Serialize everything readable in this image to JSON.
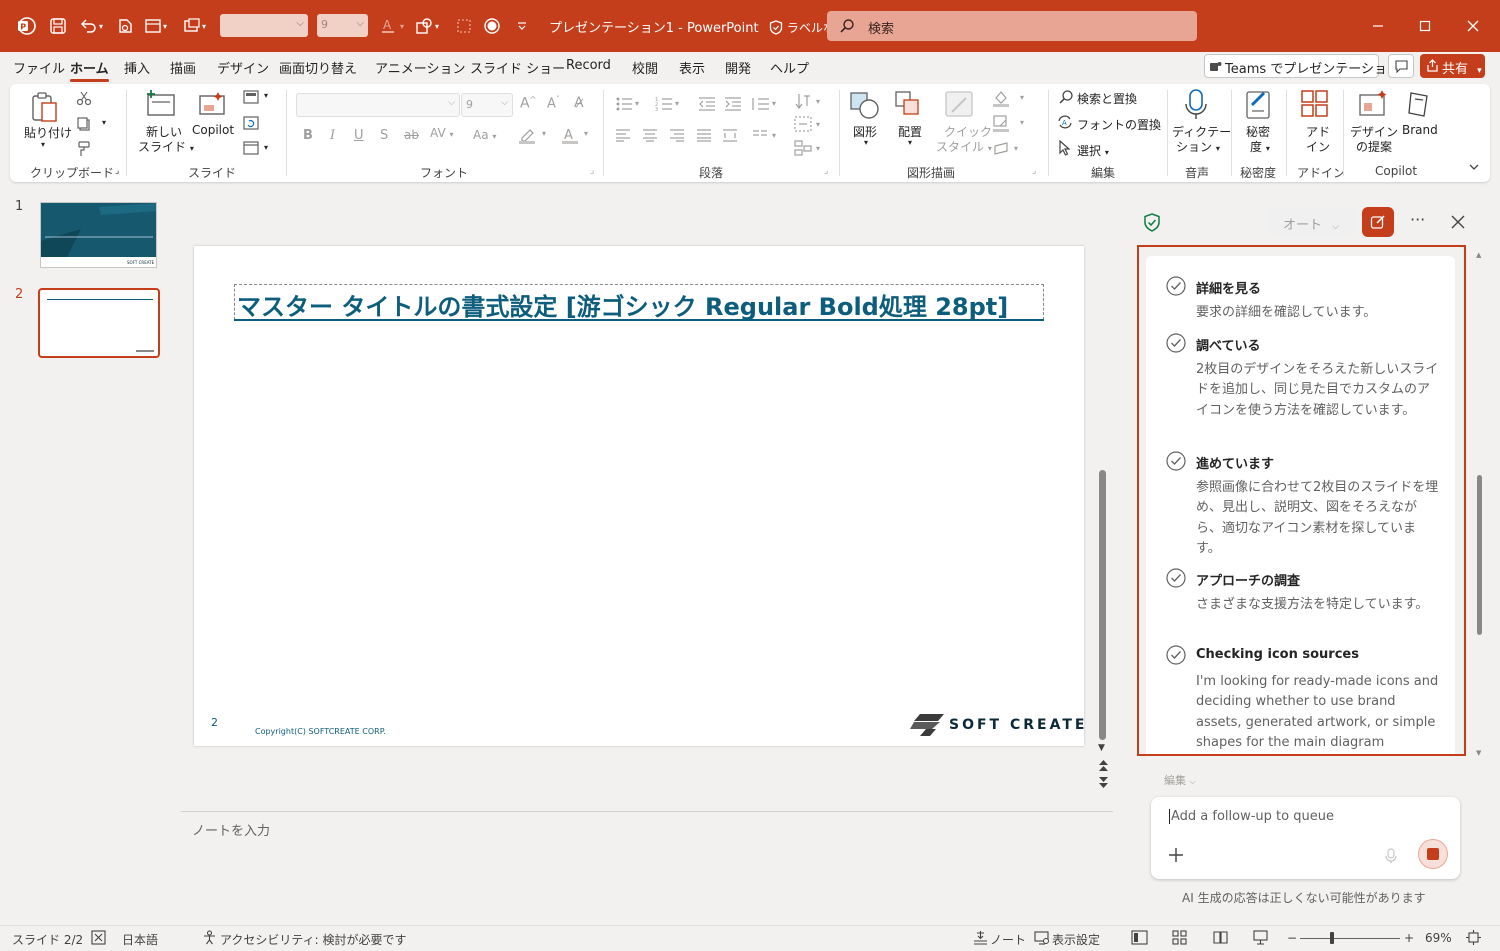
{
  "titlebar": {
    "doc_title": "プレゼンテーション1",
    "separator": "-",
    "app_name": "PowerPoint",
    "label": "ラベルなし",
    "font_size_value": "9",
    "search_placeholder": "検索"
  },
  "tabs": [
    "ファイル",
    "ホーム",
    "挿入",
    "描画",
    "デザイン",
    "画面切り替え",
    "アニメーション",
    "スライド ショー",
    "Record",
    "校閲",
    "表示",
    "開発",
    "ヘルプ"
  ],
  "tabs_right": {
    "teams": "Teams でプレゼンテーション",
    "share": "共有"
  },
  "ribbon": {
    "paste": "貼り付け",
    "new_slide_1": "新しい",
    "new_slide_2": "スライド",
    "copilot": "Copilot",
    "font_size": "9",
    "shapes": "図形",
    "arrange": "配置",
    "quick_style_1": "クイック",
    "quick_style_2": "スタイル",
    "find": "検索と置換",
    "replace_font": "フォントの置換",
    "select": "選択",
    "dictate_1": "ディクテー",
    "dictate_2": "ション",
    "sensitivity_1": "秘密",
    "sensitivity_2": "度",
    "addin_1": "アド",
    "addin_2": "イン",
    "designer_1": "デザイン",
    "designer_2": "の提案",
    "brand": "Brand",
    "groups": {
      "clipboard": "クリップボード",
      "slides": "スライド",
      "font": "フォント",
      "paragraph": "段落",
      "drawing": "図形描画",
      "editing": "編集",
      "voice": "音声",
      "sensitivity": "秘密度",
      "addins": "アドイン",
      "copilot": "Copilot"
    }
  },
  "thumbnails": {
    "n1": "1",
    "n2": "2",
    "thumb_logo": "SOFT CREATE"
  },
  "slide": {
    "title": "マスター タイトルの書式設定 [游ゴシック Regular Bold処理 28pt]",
    "number": "2",
    "copyright": "Copyright(C) SOFTCREATE CORP.",
    "logo": "SOFT CREATE"
  },
  "notes_placeholder": "ノートを入力",
  "copilot": {
    "mode": "オート",
    "steps": [
      {
        "title": "詳細を見る",
        "desc": "要求の詳細を確認しています。"
      },
      {
        "title": "調べている",
        "desc": "2枚目のデザインをそろえた新しいスライドを追加し、同じ見た目でカスタムのアイコンを使う方法を確認しています。"
      },
      {
        "title": "進めています",
        "desc": "参照画像に合わせて2枚目のスライドを埋め、見出し、説明文、図をそろえながら、適切なアイコン素材を探しています。"
      },
      {
        "title": "アプローチの調査",
        "desc": "さまざまな支援方法を特定しています。"
      },
      {
        "title": "Checking icon sources",
        "desc": "I'm looking for ready-made icons and deciding whether to use brand assets, generated artwork, or simple shapes for the main diagram elements."
      }
    ],
    "edit_label": "編集",
    "input_placeholder": "Add a follow-up to queue",
    "disclaimer": "AI 生成の応答は正しくない可能性があります"
  },
  "status": {
    "slide": "スライド 2/2",
    "language": "日本語",
    "accessibility": "アクセシビリティ: 検討が必要です",
    "notes": "ノート",
    "display": "表示設定",
    "zoom": "69%"
  },
  "colors": {
    "accent": "#c43e1c",
    "slide_title": "#0d5d7c",
    "thumb_bg": "#16586e"
  }
}
